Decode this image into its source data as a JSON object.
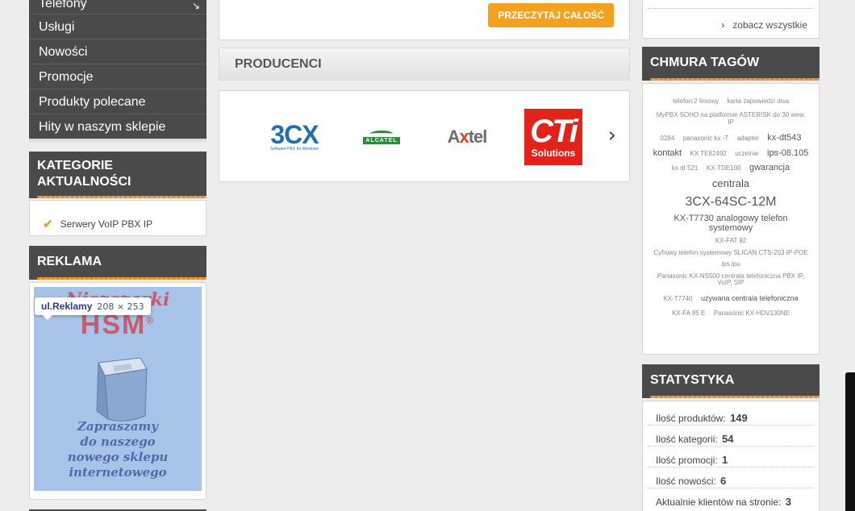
{
  "menu": {
    "items": [
      {
        "label": "Telefony"
      },
      {
        "label": "Usługi"
      },
      {
        "label": "Nowości"
      },
      {
        "label": "Promocje"
      },
      {
        "label": "Produkty polecane"
      },
      {
        "label": "Hity w naszym sklepie"
      }
    ]
  },
  "categories_news": {
    "title": "KATEGORIE AKTUALNOŚCI",
    "items": [
      {
        "label": "Serwery VoIP PBX IP"
      }
    ]
  },
  "ad": {
    "title": "REKLAMA",
    "tooltip_name": "ul.Reklamy",
    "tooltip_size": "208 × 253",
    "line1": "Niszczarki",
    "line2": "HSM",
    "registered": "®",
    "line3": "Zapraszamy",
    "line4": "do naszego",
    "line5": "nowego sklepu",
    "line6": "internetowego"
  },
  "article": {
    "read_more": "PRZECZYTAJ CAŁOŚĆ"
  },
  "producers": {
    "title": "PRODUCENCI",
    "logos": {
      "threecx": "3CX",
      "threecx_tag": "Software PBX for Windows",
      "alcatel": "ALCATEL",
      "axtel_a": "A",
      "axtel_x": "x",
      "axtel_rest": "tel",
      "cti": "CTi",
      "cti_sub": "Solutions"
    },
    "next": "›"
  },
  "see_all": {
    "label": "zobacz wszystkie"
  },
  "tag_cloud": {
    "title": "CHMURA TAGÓW",
    "tags": {
      "t1": "telefon 2 liniowy",
      "t2": "karta zapowiedzi disa",
      "t3": "MyPBX SOHO na platformie ASTERISK do 30 wew. IP",
      "t4": "0284",
      "t5": "panasonic kx -T",
      "t6": "adapter",
      "t7": "kx-dt543",
      "t8": "kontakt",
      "t9": "KX TE82492",
      "t10": "uczelnie",
      "t11": "ips-08.105",
      "t12": "kx dt 521",
      "t13": "KX-TDE100",
      "t14": "gwarancja",
      "t15": "centrala",
      "t16": "3CX-64SC-12M",
      "t17": "KX-T7730 analogowy telefon systemowy",
      "t18": "KX-FAT 92",
      "t19": "Cyfrowy telefon systemowy SLICAN CTS-203 IP-POE",
      "t20": "ips ipu",
      "t21": "Panasonic KX-NS500 centrala telefoniczna PBX IP, VoIP, SIP",
      "t22": "KX-T7740",
      "t23": "używana centrala telefoniczna",
      "t24": "KX-FA 85 E",
      "t25": "Panasonic KX-HDV130NE"
    }
  },
  "stats": {
    "title": "STATYSTYKA",
    "rows": [
      {
        "label": "Ilość produktów:",
        "value": "149"
      },
      {
        "label": "Ilość kategorii:",
        "value": "54"
      },
      {
        "label": "Ilość promocji:",
        "value": "1"
      },
      {
        "label": "Ilość nowości:",
        "value": "6"
      },
      {
        "label": "Aktualnie klientów na stronie:",
        "value": "3"
      }
    ]
  },
  "colors": {
    "accent": "#f3a11f",
    "header": "#4a4a4a"
  }
}
